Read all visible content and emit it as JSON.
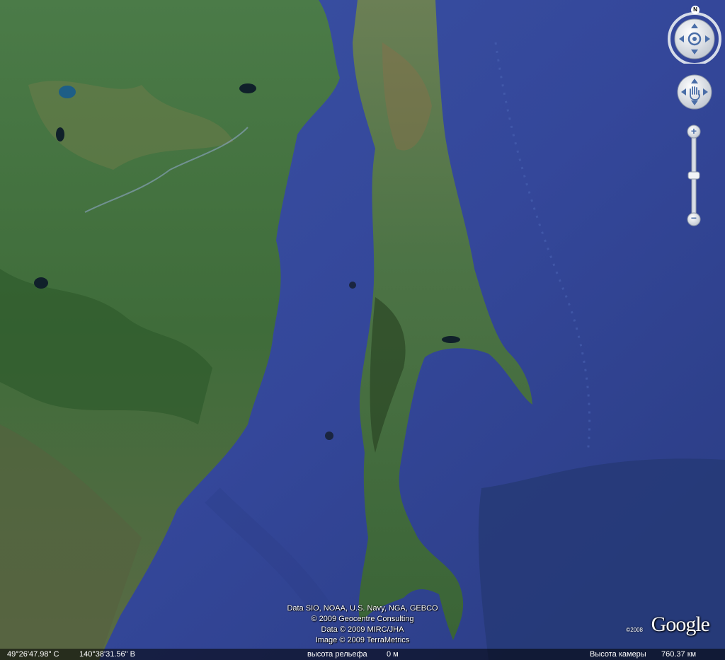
{
  "compass": {
    "north_label": "N"
  },
  "attribution": [
    "Data SIO, NOAA, U.S. Navy, NGA, GEBCO",
    "© 2009 Geocentre Consulting",
    "Data © 2009 MIRC/JHA",
    "Image © 2009 TerraMetrics"
  ],
  "logo": {
    "year": "©2008",
    "text": "Google"
  },
  "status_bar": {
    "latitude": "49°26'47.98\" С",
    "longitude": "140°38'31.56\" В",
    "elevation_label": "высота рельефа",
    "elevation_value": "0 м",
    "camera_label": "Высота камеры",
    "camera_value": "760.37 км"
  },
  "zoom": {
    "plus": "+",
    "minus": "−"
  },
  "colors": {
    "ocean": "#33468f",
    "deep_ocean": "#263977",
    "land": "#3f6b3a",
    "forest": "#2c5a2e"
  }
}
